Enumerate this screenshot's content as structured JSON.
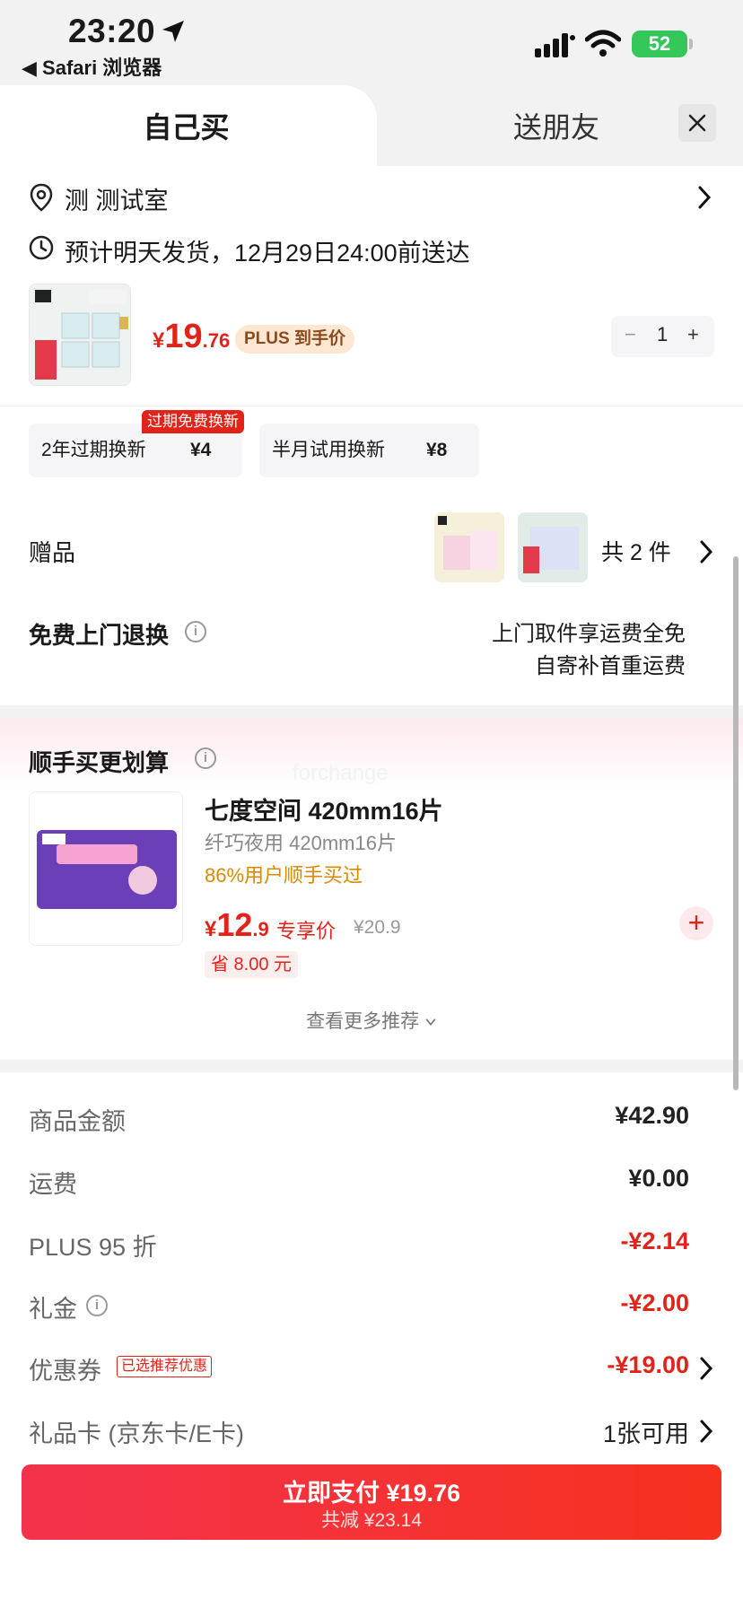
{
  "status_bar": {
    "time": "23:20",
    "back_app": "◀ Safari 浏览器",
    "battery": "52"
  },
  "tabs": {
    "self_buy": "自己买",
    "gift_friend": "送朋友"
  },
  "address": {
    "text": "测 测试室"
  },
  "delivery": {
    "text": "预计明天发货，12月29日24:00前送达"
  },
  "product": {
    "price_currency": "¥",
    "price_int": "19",
    "price_dec": ".76",
    "plus_tag": "PLUS 到手价",
    "quantity": "1",
    "minus": "−",
    "plus": "+"
  },
  "services": {
    "badge": "过期免费换新",
    "items": [
      {
        "name": "2年过期换新",
        "price": "¥4"
      },
      {
        "name": "半月试用换新",
        "price": "¥8"
      }
    ]
  },
  "gifts": {
    "label": "赠品",
    "count": "共 2 件"
  },
  "return": {
    "label": "免费上门退换",
    "line1": "上门取件享运费全免",
    "line2": "自寄补首重运费"
  },
  "recommend": {
    "title": "顺手买更划算",
    "watermark": "forchange",
    "name": "七度空间 420mm16片",
    "sub": "纤巧夜用 420mm16片",
    "bought": "86%用户顺手买过",
    "price_currency": "¥",
    "price_int": "12",
    "price_dec": ".9",
    "exclusive": "专享价",
    "original": "¥20.9",
    "save": "省 8.00 元",
    "add": "+",
    "see_more": "查看更多推荐"
  },
  "summary": {
    "rows": [
      {
        "label": "商品金额",
        "value": "¥42.90"
      },
      {
        "label": "运费",
        "value": "¥0.00"
      },
      {
        "label": "PLUS 95 折",
        "value": "-¥2.14"
      },
      {
        "label": "礼金",
        "value": "-¥2.00"
      },
      {
        "label": "优惠券",
        "value": "-¥19.00",
        "tag": "已选推荐优惠"
      },
      {
        "label": "礼品卡 (京东卡/E卡)",
        "value": "1张可用"
      }
    ]
  },
  "pay": {
    "main": "立即支付 ¥19.76",
    "sub": "共减 ¥23.14"
  },
  "colors": {
    "accent_red": "#e2231a",
    "pay_start": "#f3334d",
    "pay_end": "#f7311f",
    "battery_green": "#34c759"
  }
}
